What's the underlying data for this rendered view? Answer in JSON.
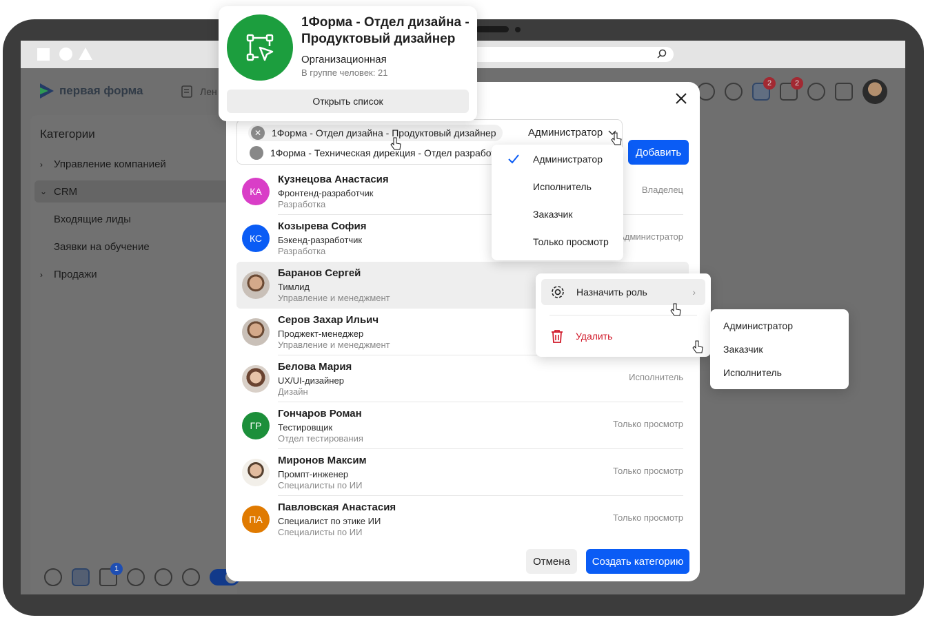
{
  "app": {
    "logo_text": "первая форма",
    "nav_feed": "Лен",
    "badges": {
      "alerts": "2",
      "tasks": "2",
      "mail": "1"
    }
  },
  "sidebar": {
    "title": "Категории",
    "items": [
      {
        "label": "Управление компанией"
      },
      {
        "label": "CRM"
      },
      {
        "label": "Продажи"
      }
    ],
    "crm_children": [
      "Входящие лиды",
      "Заявки на обучение"
    ]
  },
  "group_card": {
    "title": "1Форма - Отдел дизайна - Продуктовый дизайнер",
    "type": "Организационная",
    "count": "В группе человек: 21",
    "button": "Открыть список"
  },
  "modal": {
    "selected_tags": [
      {
        "label": "1Форма - Отдел дизайна - Продуктовый дизайнер"
      },
      {
        "label": "1Форма - Техническая дирекция - Отдел разработки"
      }
    ],
    "role_value": "Администратор",
    "add_button": "Добавить",
    "members": [
      {
        "initials": "КА",
        "color": "#d93ec7",
        "name": "Кузнецова Анастасия",
        "position": "Фронтенд-разработчик",
        "dept": "Разработка",
        "role": "Владелец"
      },
      {
        "initials": "КС",
        "color": "#0a5cf5",
        "name": "Козырева София",
        "position": "Бэкенд-разработчик",
        "dept": "Разработка",
        "role": "Администратор"
      },
      {
        "initials": "",
        "color": "",
        "name": "Баранов Сергей",
        "position": "Тимлид",
        "dept": "Управление и менеджмент",
        "role": ""
      },
      {
        "initials": "",
        "color": "",
        "name": "Серов Захар Ильич",
        "position": "Проджект-менеджер",
        "dept": "Управление и менеджмент",
        "role": ""
      },
      {
        "initials": "",
        "color": "",
        "name": "Белова Мария",
        "position": "UX/UI-дизайнер",
        "dept": "Дизайн",
        "role": "Исполнитель"
      },
      {
        "initials": "ГР",
        "color": "#1c8f3a",
        "name": "Гончаров Роман",
        "position": "Тестировщик",
        "dept": "Отдел тестирования",
        "role": "Только просмотр"
      },
      {
        "initials": "",
        "color": "",
        "name": "Миронов Максим",
        "position": "Промпт-инженер",
        "dept": "Специалисты по ИИ",
        "role": "Только просмотр"
      },
      {
        "initials": "ПА",
        "color": "#e07a00",
        "name": "Павловская Анастасия",
        "position": "Специалист по этике ИИ",
        "dept": "Специалисты по ИИ",
        "role": "Только просмотр"
      }
    ],
    "cancel_button": "Отмена",
    "create_button": "Создать категорию"
  },
  "role_menu": {
    "options": [
      "Администратор",
      "Исполнитель",
      "Заказчик",
      "Только просмотр"
    ],
    "selected": "Администратор"
  },
  "context_menu": {
    "assign_role": "Назначить роль",
    "delete": "Удалить",
    "submenu": [
      "Администратор",
      "Заказчик",
      "Исполнитель"
    ]
  },
  "colors": {
    "primary": "#0a5cf5",
    "danger": "#d11a2a",
    "group_icon": "#1c9e3e"
  }
}
